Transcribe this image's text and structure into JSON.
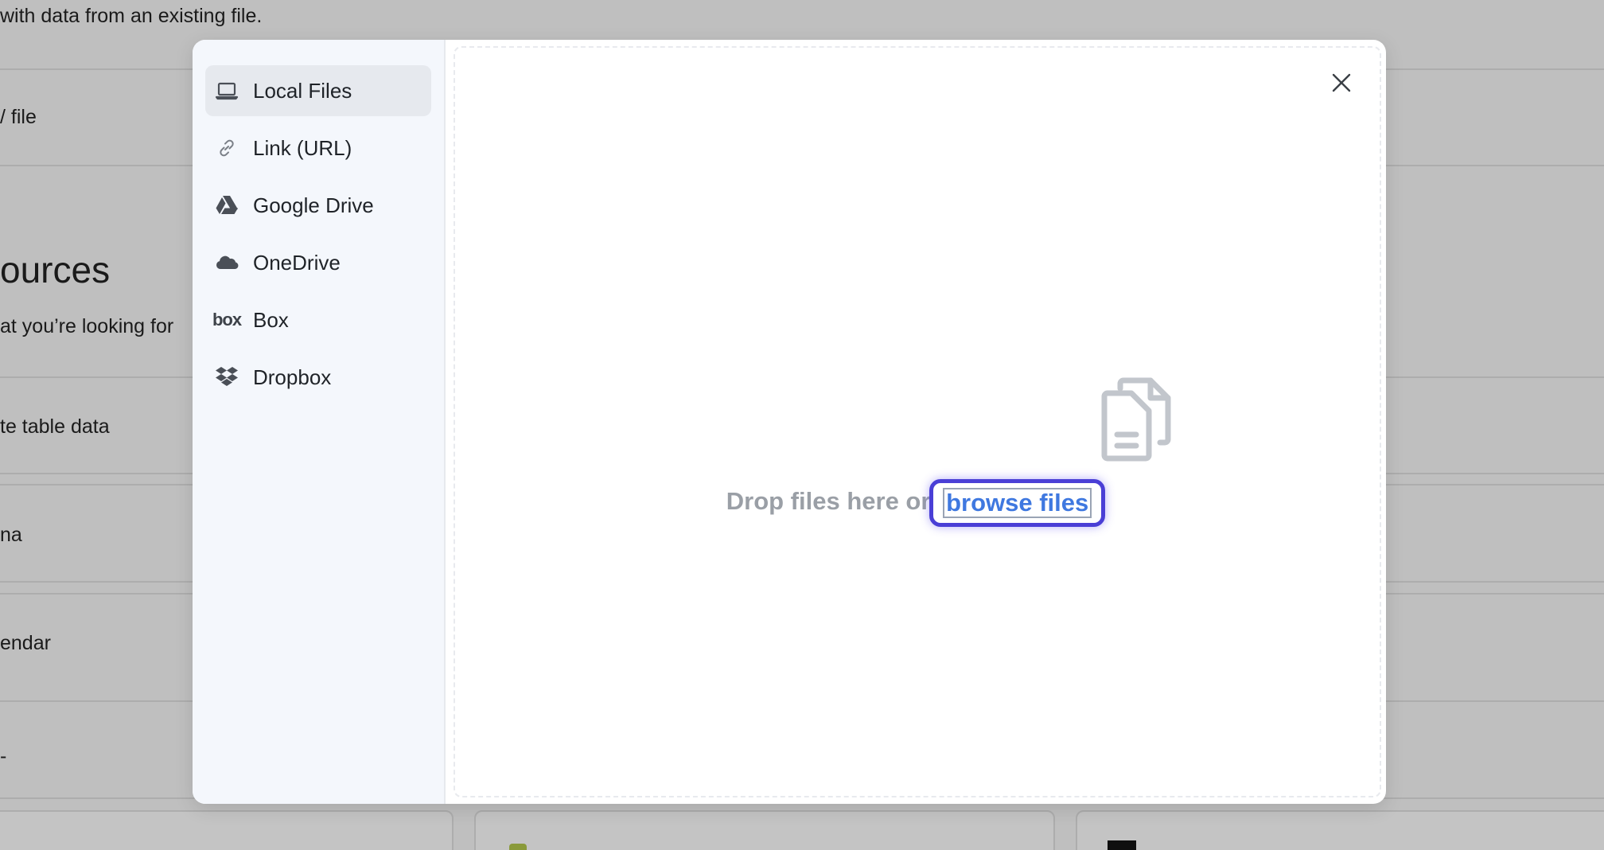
{
  "background": {
    "texts": [
      "with data from an existing file.",
      "/ file",
      "at you’re looking for",
      "te table data",
      "na",
      "endar",
      "-"
    ],
    "heading": "ources"
  },
  "modal": {
    "sidebar": {
      "items": [
        {
          "label": "Local Files",
          "icon": "laptop-icon",
          "active": true
        },
        {
          "label": "Link (URL)",
          "icon": "link-icon"
        },
        {
          "label": "Google Drive",
          "icon": "google-drive-icon"
        },
        {
          "label": "OneDrive",
          "icon": "onedrive-icon"
        },
        {
          "label": "Box",
          "icon": "box-icon",
          "logo_text": "box"
        },
        {
          "label": "Dropbox",
          "icon": "dropbox-icon"
        }
      ]
    },
    "dropzone": {
      "prompt": "Drop files here or",
      "browse_label": "browse files",
      "icon": "files-icon"
    },
    "close_icon": "close-icon"
  },
  "colors": {
    "overlay_bg": "#bfbfbf",
    "sidebar_bg": "#f4f7fc",
    "active_item_bg": "#e6e9ee",
    "link_color": "#3f78e0",
    "focus_ring": "#4a3fd6",
    "muted_text": "#9a9fa6"
  }
}
